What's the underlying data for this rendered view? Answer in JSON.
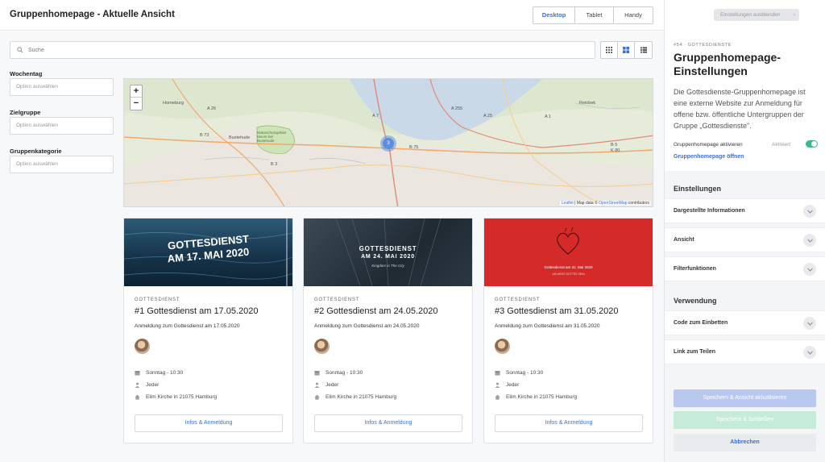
{
  "header": {
    "title": "Gruppenhomepage - Aktuelle Ansicht",
    "devices": [
      "Desktop",
      "Tablet",
      "Handy"
    ],
    "active_device": "Desktop"
  },
  "search": {
    "placeholder": "Suche",
    "value": ""
  },
  "view_modes": [
    "grid-small-icon",
    "grid-large-icon",
    "list-icon"
  ],
  "filters": [
    {
      "label": "Wochentag",
      "placeholder": "Option auswählen"
    },
    {
      "label": "Zielgruppe",
      "placeholder": "Option auswählen"
    },
    {
      "label": "Gruppenkategorie",
      "placeholder": "Option auswählen"
    }
  ],
  "map": {
    "zoom_in": "+",
    "zoom_out": "−",
    "cluster_count": "3",
    "places": [
      "Horneburg",
      "Buxtehude",
      "Reinbek",
      "Naturschutzgebiet Moore bei Buxtehude",
      "A 26",
      "A 7",
      "A 255",
      "A 25",
      "A 1",
      "B 73",
      "B 3",
      "B 5",
      "K 80",
      "B 75"
    ],
    "attribution_leaflet": "Leaflet",
    "attribution_text": "| Map data ©",
    "attribution_osm": "OpenStreetMap",
    "attribution_suffix": "contributors"
  },
  "cards": [
    {
      "image_headline_1": "GOTTESDIENST",
      "image_headline_2": "AM 17. MAI 2020",
      "category": "GOTTESDIENST",
      "title": "#1 Gottesdienst am 17.05.2020",
      "description": "Anmeldung zum Gottesdienst am 17.05.2020",
      "time": "Sonntag - 10:30",
      "audience": "Jeder",
      "location": "Elim Kirche in 21075 Hamburg",
      "button": "Infos & Anmeldung"
    },
    {
      "image_headline_1": "GOTTESDIENST",
      "image_headline_2": "AM 24. MAI 2020",
      "image_sub": "Kingdom in The City",
      "category": "GOTTESDIENST",
      "title": "#2 Gottesdienst am 24.05.2020",
      "description": "Anmeldung zum Gottesdienst am 24.05.2020",
      "time": "Sonntag - 10:30",
      "audience": "Jeder",
      "location": "Elim Kirche in 21075 Hamburg",
      "button": "Infos & Anmeldung"
    },
    {
      "image_headline_1": "Gottesdienst am 31. Mai 2020",
      "image_sub": "AM HERZ GOTTES SEIN",
      "category": "GOTTESDIENST",
      "title": "#3 Gottesdienst am 31.05.2020",
      "description": "Anmeldung zum Gottesdienst am 31.05.2020",
      "time": "Sonntag - 10:30",
      "audience": "Jeder",
      "location": "Elim Kirche in 21075 Hamburg",
      "button": "Infos & Anmeldung"
    }
  ],
  "panel": {
    "hide_button": "Einstellungen ausblenden",
    "kicker": "#54 · GOTTESDIENSTE",
    "title": "Gruppenhomepage-Einstellungen",
    "description": "Die Gottesdienste-Gruppenhomepage ist eine externe Website zur Anmeldung für offene bzw. öffentliche Untergruppen der Gruppe „Gottesdienste\".",
    "toggle_label": "Gruppenhomepage aktivieren",
    "toggle_state": "Aktiviert",
    "open_link": "Gruppenhomepage öffnen",
    "section_settings": "Einstellungen",
    "settings_items": [
      "Dargestellte Informationen",
      "Ansicht",
      "Filterfunktionen"
    ],
    "section_usage": "Verwendung",
    "usage_items": [
      "Code zum Einbetten",
      "Link zum Teilen"
    ],
    "btn_save_update": "Speichern & Ansicht aktualisieren",
    "btn_save_close": "Speichern & Schließen",
    "btn_cancel": "Abbrechen"
  },
  "colors": {
    "accent": "#3b6fd8",
    "toggle_on": "#3bb98a",
    "card1_bg": "#1d3b52",
    "card2_bg": "#2d3a45",
    "card3_bg": "#d42a2a"
  }
}
